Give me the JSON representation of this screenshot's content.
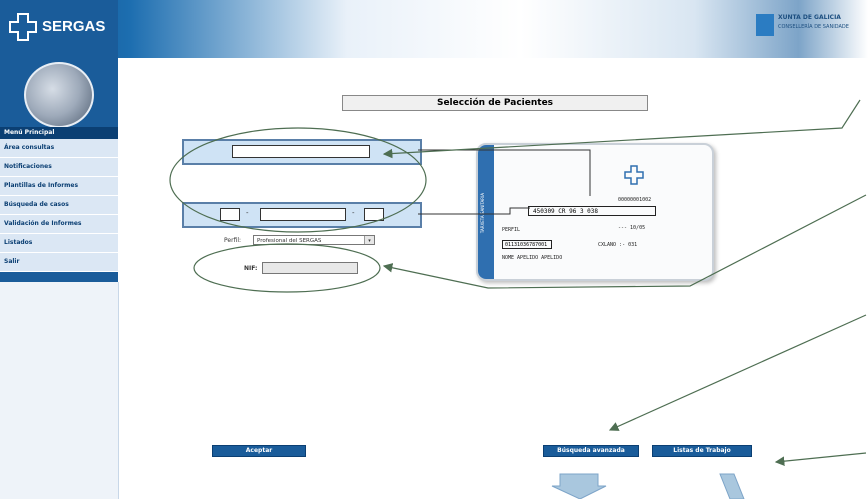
{
  "header": {
    "brand": "SERGAS",
    "xunta_line1": "XUNTA DE GALICIA",
    "xunta_line2": "CONSELLERÍA DE SANIDADE"
  },
  "sidebar": {
    "menu_title": "Menú Principal",
    "items": [
      {
        "label": "Área consultas"
      },
      {
        "label": "Notificaciones"
      },
      {
        "label": "Plantillas de Informes"
      },
      {
        "label": "Búsqueda de casos"
      },
      {
        "label": "Validación de Informes"
      },
      {
        "label": "Listados"
      },
      {
        "label": "Salir"
      }
    ]
  },
  "main": {
    "title": "Selección de Pacientes",
    "row2_sep1": "-",
    "row2_sep2": "-",
    "profile_label": "Perfil:",
    "profile_selected": "Profesional del SERGAS",
    "nif_label": "NIF:"
  },
  "card": {
    "stripe_text": "TARXETA SANITARIA",
    "top_number": "00000001002",
    "main_number": "450309 CR 96 3 038",
    "line_label": "PERFIL",
    "line_value": "---  10/05",
    "id_value": "01131036787001",
    "cnxano": "CXLANO :- 031",
    "name": "NOME  APELIDO  APELIDO"
  },
  "buttons": {
    "accept": "Aceptar",
    "advanced_search": "Búsqueda avanzada",
    "work_lists": "Listas de Trabajo"
  },
  "colors": {
    "brand_blue": "#1a5c9a",
    "annotation_green": "#4e6e52"
  }
}
